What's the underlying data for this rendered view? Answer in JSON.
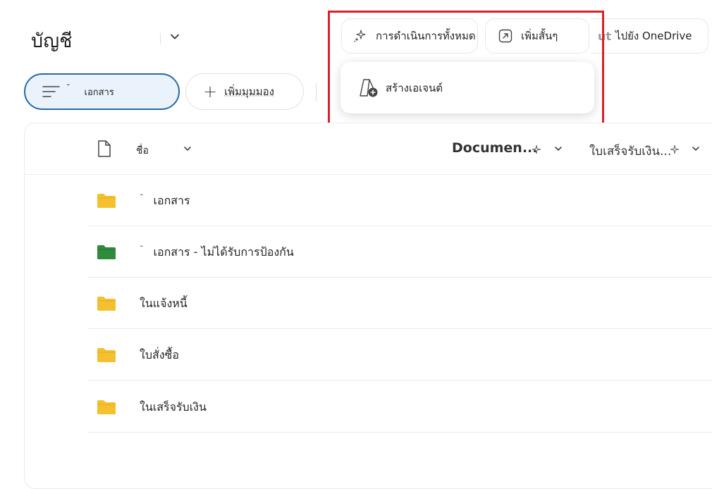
{
  "header": {
    "title": "บัญชี"
  },
  "toolbar": {
    "actions_label": "การดำเนินการทั้งหมด",
    "shortcut_label": "เพิ่มสั้นๆ",
    "onedrive_prefix": "ut",
    "onedrive_label": "ไปยัง OneDrive"
  },
  "dropdown": {
    "create_agent_label": "สร้างเอเจนต์"
  },
  "views": {
    "mark": "˜",
    "current_view": "เอกสาร",
    "add_view_label": "เพิ่มมุมมอง"
  },
  "columns": {
    "name": "ชื่อ",
    "documents": "Documen...",
    "receipts": "ใบเสร็จรับเงิน..."
  },
  "rows": [
    {
      "mark": "˜",
      "name": "เอกสาร",
      "color": "#f5c02f"
    },
    {
      "mark": "˜",
      "name": "เอกสาร - ไม่ได้รับการป้องกัน",
      "color": "#2f8c3b"
    },
    {
      "mark": "",
      "name": "ในแจ้งหนี้",
      "color": "#f5c02f"
    },
    {
      "mark": "",
      "name": "ใบสั่งซื้อ",
      "color": "#f5c02f"
    },
    {
      "mark": "",
      "name": "ในเสร็จรับเงิน",
      "color": "#f5c02f"
    }
  ],
  "colors": {
    "highlight": "#d92228",
    "view_border": "#2768a6",
    "folder_yellow": "#f5c02f",
    "folder_green": "#2f8c3b"
  }
}
